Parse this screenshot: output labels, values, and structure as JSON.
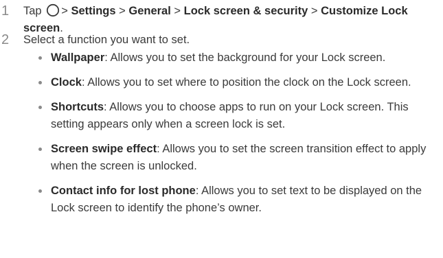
{
  "steps": [
    {
      "number": "1",
      "pre": "Tap",
      "icon": "home-circle-icon",
      "path": [
        {
          "sep": ">",
          "label": "Settings"
        },
        {
          "sep": ">",
          "label": "General"
        },
        {
          "sep": ">",
          "label": "Lock screen & security"
        },
        {
          "sep": ">",
          "label": "Customize Lock screen"
        }
      ],
      "end": "."
    },
    {
      "number": "2",
      "text": "Select a function you want to set."
    }
  ],
  "options": [
    {
      "title": "Wallpaper",
      "desc": ": Allows you to set the background for your Lock screen."
    },
    {
      "title": "Clock",
      "desc": ": Allows you to set where to position the clock on the Lock screen."
    },
    {
      "title": "Shortcuts",
      "desc": ": Allows you to choose apps to run on your Lock screen. This setting appears only when a screen lock is set."
    },
    {
      "title": "Screen swipe effect",
      "desc": ": Allows you to set the screen transition effect to apply when the screen is unlocked."
    },
    {
      "title": "Contact info for lost phone",
      "desc": ": Allows you to set text to be displayed on the Lock screen to identify the phone’s owner."
    }
  ],
  "colors": {
    "text": "#3a3a3a",
    "step_number": "#8a8a8a",
    "bullet": "#8a8a8a"
  }
}
